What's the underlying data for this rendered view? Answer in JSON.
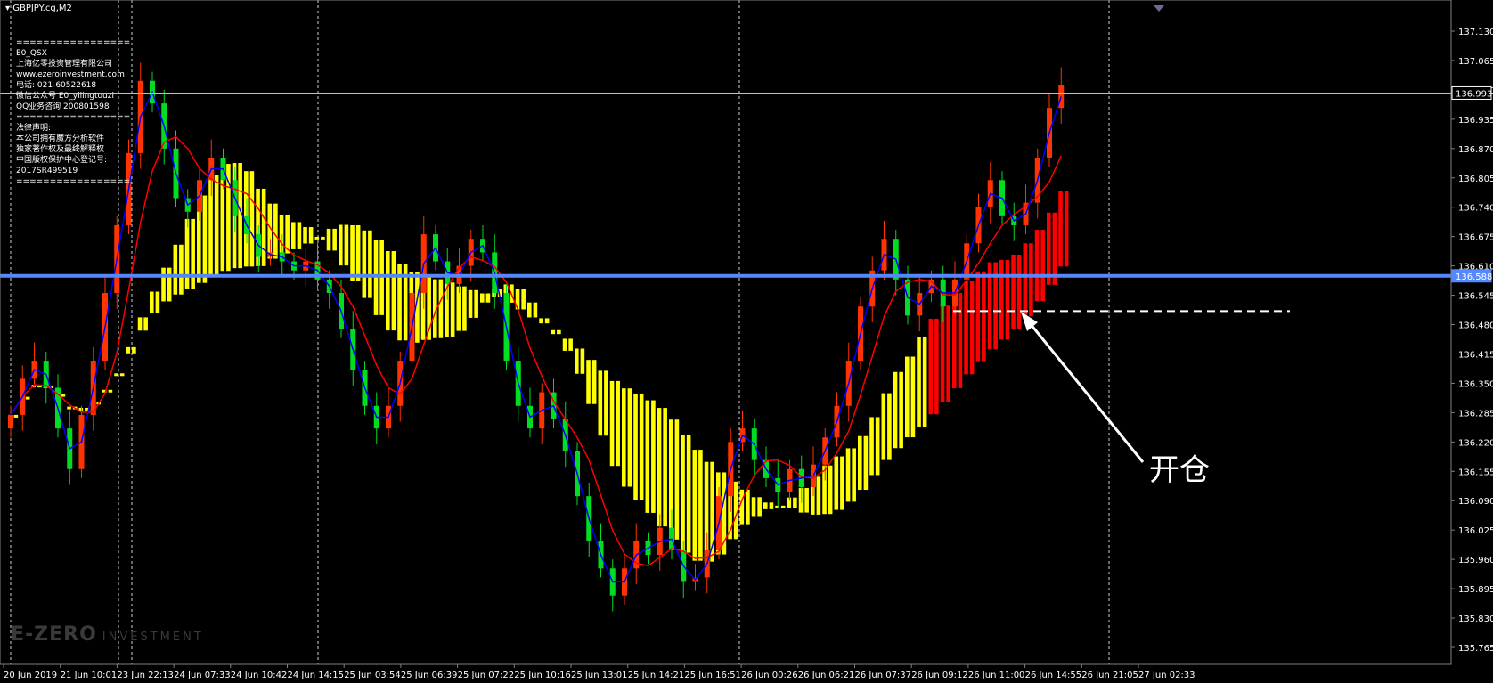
{
  "symbol_title": "GBPJPY.cg,M2",
  "info_lines_top": [
    "=================",
    "E0_QSX",
    "上海亿零投资管理有限公司",
    "www.ezeroinvestment.com",
    "电话: 021-60522618",
    "微信公众号 E0_yilingtouzi",
    "QQ业务咨询 200801598",
    "=================",
    "法律声明:",
    "本公司拥有魔方分析软件",
    "独家著作权及最终解释权",
    "中国版权保护中心登记号:",
    "2017SR499519",
    "================="
  ],
  "watermark": {
    "brand": "E-ZERO",
    "sub": "INVESTMENT"
  },
  "annotation": {
    "label": "开仓",
    "color": "#ffffff"
  },
  "colors": {
    "background": "#000000",
    "bull_candle": "#ff3300",
    "bear_candle": "#00dd22",
    "ma_fast": "#0000ff",
    "ma_slow": "#ff0000",
    "cloud_up": "#ffff00",
    "cloud_down": "#ff0000",
    "hline": "#5588ff",
    "price_line": "#c0c0c0",
    "axis_text": "#ffffff"
  },
  "chart_data": {
    "type": "candlestick",
    "y_tick_labels": [
      "137.130",
      "137.065",
      "137.000",
      "136.935",
      "136.870",
      "136.805",
      "136.740",
      "136.675",
      "136.610",
      "136.545",
      "136.480",
      "136.415",
      "136.350",
      "136.285",
      "136.220",
      "136.155",
      "136.090",
      "136.025",
      "135.960",
      "135.895",
      "135.830",
      "135.765"
    ],
    "ylim": [
      135.765,
      137.13
    ],
    "x_tick_labels": [
      "20 Jun 2019",
      "21 Jun 10:01",
      "23 Jun 22:13",
      "24 Jun 07:33",
      "24 Jun 10:42",
      "24 Jun 14:15",
      "25 Jun 03:54",
      "25 Jun 06:39",
      "25 Jun 07:22",
      "25 Jun 10:16",
      "25 Jun 13:01",
      "25 Jun 14:21",
      "25 Jun 16:51",
      "26 Jun 00:26",
      "26 Jun 06:21",
      "26 Jun 07:37",
      "26 Jun 09:12",
      "26 Jun 11:00",
      "26 Jun 14:55",
      "26 Jun 21:05",
      "27 Jun 02:33"
    ],
    "current_price": {
      "label": "136.993",
      "value": 136.993
    },
    "horizontal_line": {
      "label": "136.588",
      "value": 136.588
    },
    "entry_level": {
      "value": 136.51
    },
    "closes": [
      136.28,
      136.36,
      136.4,
      136.34,
      136.25,
      136.16,
      136.28,
      136.4,
      136.55,
      136.7,
      136.86,
      137.02,
      136.97,
      136.87,
      136.76,
      136.73,
      136.8,
      136.85,
      136.8,
      136.72,
      136.68,
      136.63,
      136.64,
      136.62,
      136.6,
      136.62,
      136.58,
      136.55,
      136.47,
      136.38,
      136.3,
      136.25,
      136.3,
      136.4,
      136.55,
      136.68,
      136.62,
      136.57,
      136.61,
      136.67,
      136.64,
      136.55,
      136.4,
      136.3,
      136.25,
      136.33,
      136.27,
      136.2,
      136.1,
      136.0,
      135.94,
      135.88,
      135.94,
      136.0,
      135.97,
      136.03,
      135.98,
      135.91,
      135.92,
      135.98,
      136.1,
      136.22,
      136.25,
      136.18,
      136.14,
      136.11,
      136.16,
      136.12,
      136.17,
      136.23,
      136.3,
      136.4,
      136.52,
      136.6,
      136.67,
      136.58,
      136.5,
      136.55,
      136.58,
      136.52,
      136.58,
      136.66,
      136.74,
      136.8,
      136.72,
      136.7,
      136.75,
      136.85,
      136.96,
      137.01
    ]
  }
}
